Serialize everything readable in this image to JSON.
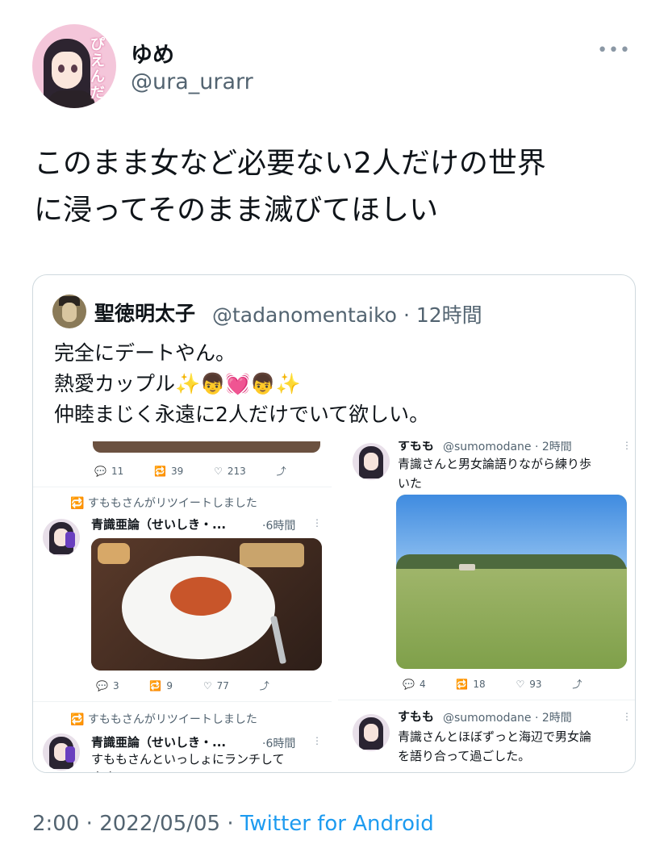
{
  "tweet": {
    "author": {
      "name": "ゆめ",
      "handle": "@ura_urarr",
      "avatar_text": "ぴえんだよ"
    },
    "more_label": "•••",
    "text_line1": "このまま女など必要ない2人だけの世界",
    "text_line2": "に浸ってそのまま滅びてほしい",
    "footer": {
      "time": "2:00",
      "sep1": "·",
      "date": "2022/05/05",
      "sep2": "·",
      "client": "Twitter for Android"
    }
  },
  "quote": {
    "name": "聖徳明太子",
    "handle": "@tadanomentaiko",
    "dot": "·",
    "time": "12時間",
    "line1": "完全にデートやん。",
    "line2_text": "熱愛カップル",
    "line2_emoji": "✨👦💓👦✨",
    "line3": "仲睦まじく永遠に2人だけでいて欲しい。"
  },
  "embedded": {
    "left": {
      "top_actions": {
        "reply": "11",
        "retweet": "39",
        "like": "213"
      },
      "rt1": "すももさんがリツイートしました",
      "post1": {
        "name": "青識亜論（せいしき・...",
        "time": "·6時間",
        "actions": {
          "reply": "3",
          "retweet": "9",
          "like": "77"
        }
      },
      "rt2": "すももさんがリツイートしました",
      "post2": {
        "name": "青識亜論（せいしき・...",
        "time": "·6時間",
        "text": "すももさんといっしょにランチして",
        "text2": "ます"
      }
    },
    "right": {
      "post1": {
        "name": "すもも",
        "handle": "@sumomodane · 2時間",
        "line1": "青識さんと男女論語りながら練り歩",
        "line2": "いた",
        "actions": {
          "reply": "4",
          "retweet": "18",
          "like": "93"
        }
      },
      "post2": {
        "name": "すもも",
        "handle": "@sumomodane · 2時間",
        "line1": "青識さんとほぼずっと海辺で男女論",
        "line2": "を語り合って過ごした。"
      }
    }
  },
  "colors": {
    "text": "#0f1419",
    "secondary": "#536471",
    "link": "#1d9bf0",
    "border": "#cfd9de"
  }
}
